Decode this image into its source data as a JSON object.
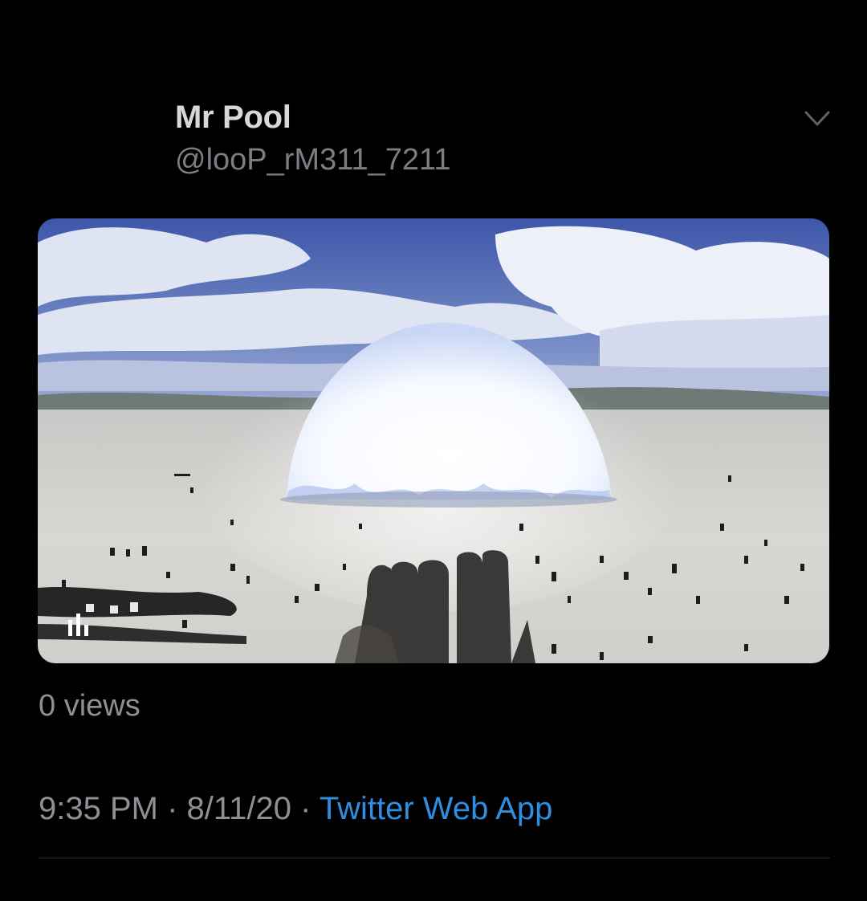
{
  "tweet": {
    "display_name": "Mr Pool",
    "handle": "@looP_rM311_7211",
    "views": "0 views",
    "time": "9:35 PM",
    "separator": "·",
    "date": "8/11/20",
    "source": "Twitter Web App"
  },
  "icons": {
    "menu": "chevron-down-icon",
    "media_audio": "audio-bars-icon"
  },
  "colors": {
    "background": "#000000",
    "link": "#2e8ee0",
    "secondary_text": "#8d9196",
    "primary_text": "#d8d8d8"
  }
}
